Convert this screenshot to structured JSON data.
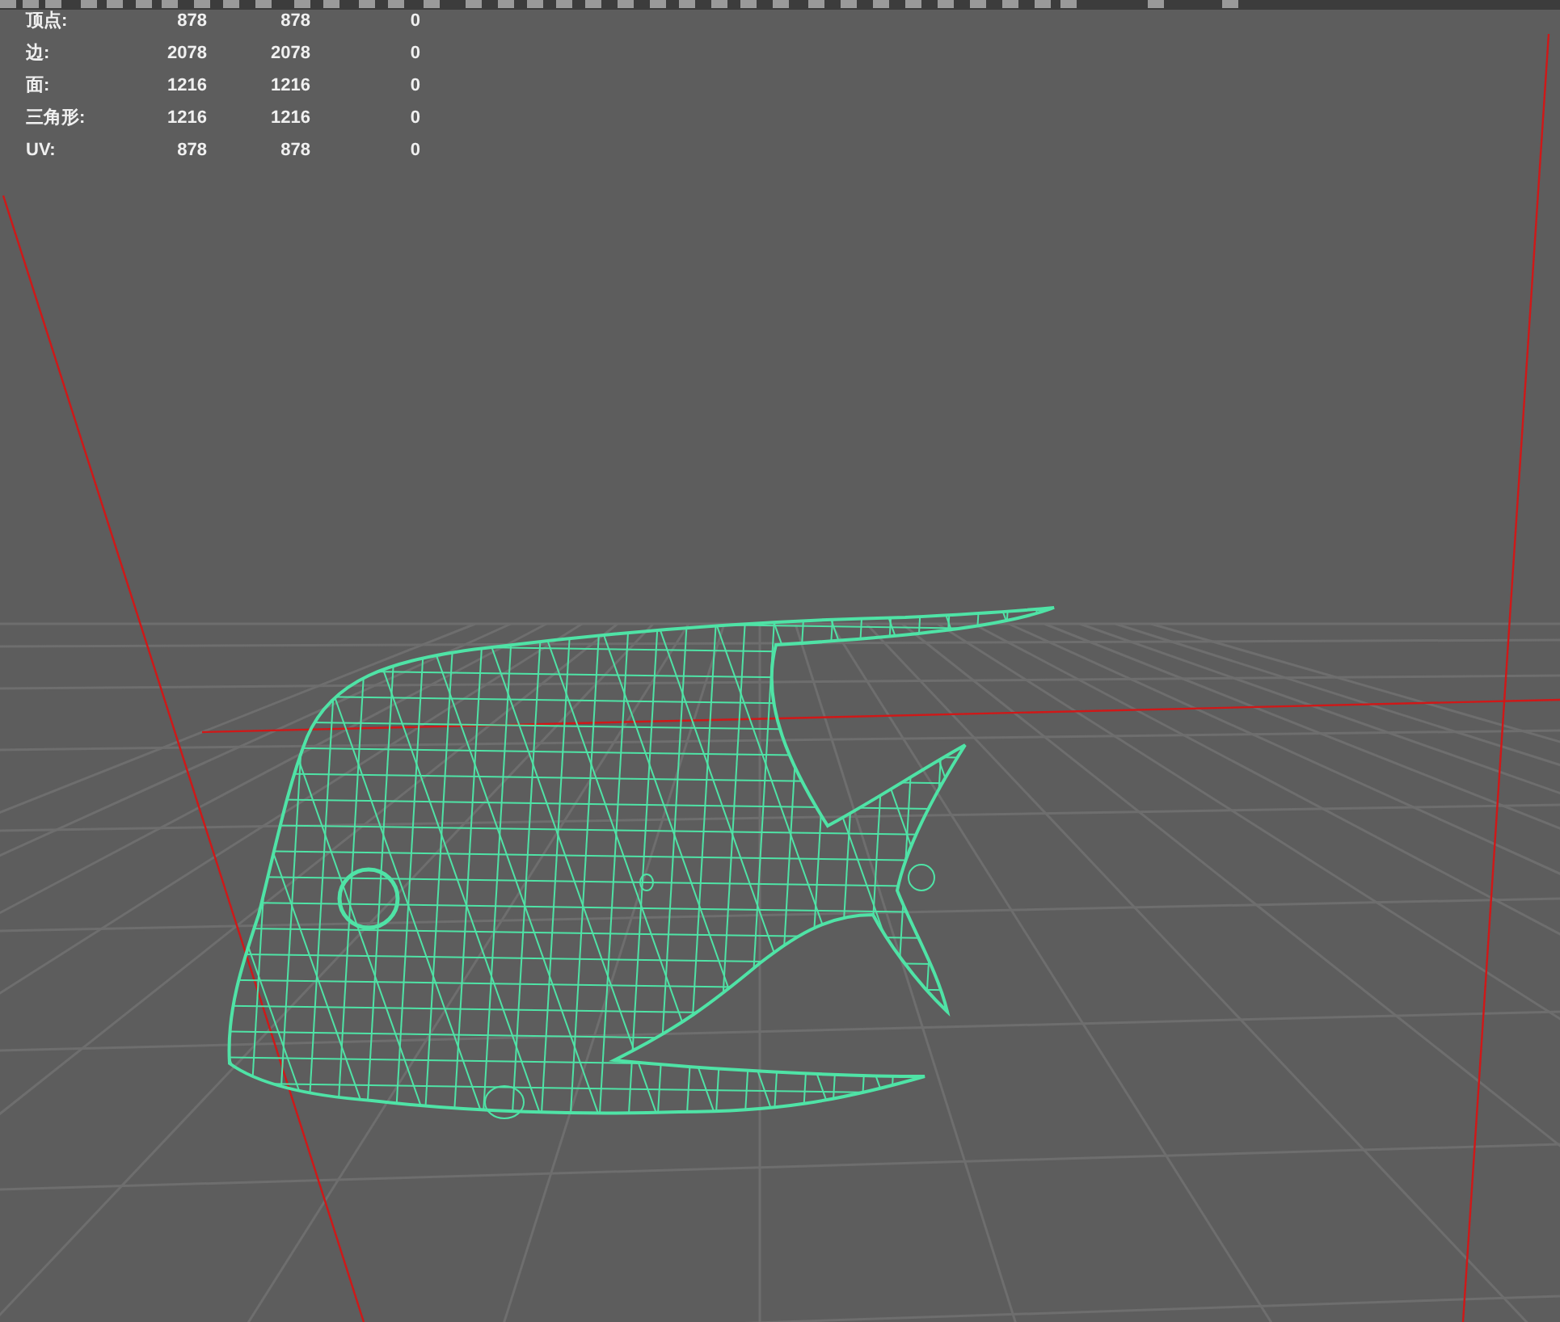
{
  "stats": [
    {
      "label": "顶点:",
      "values": [
        "878",
        "878",
        "0"
      ]
    },
    {
      "label": "边:",
      "values": [
        "2078",
        "2078",
        "0"
      ]
    },
    {
      "label": "面:",
      "values": [
        "1216",
        "1216",
        "0"
      ]
    },
    {
      "label": "三角形:",
      "values": [
        "1216",
        "1216",
        "0"
      ]
    },
    {
      "label": "UV:",
      "values": [
        "878",
        "878",
        "0"
      ]
    }
  ]
}
